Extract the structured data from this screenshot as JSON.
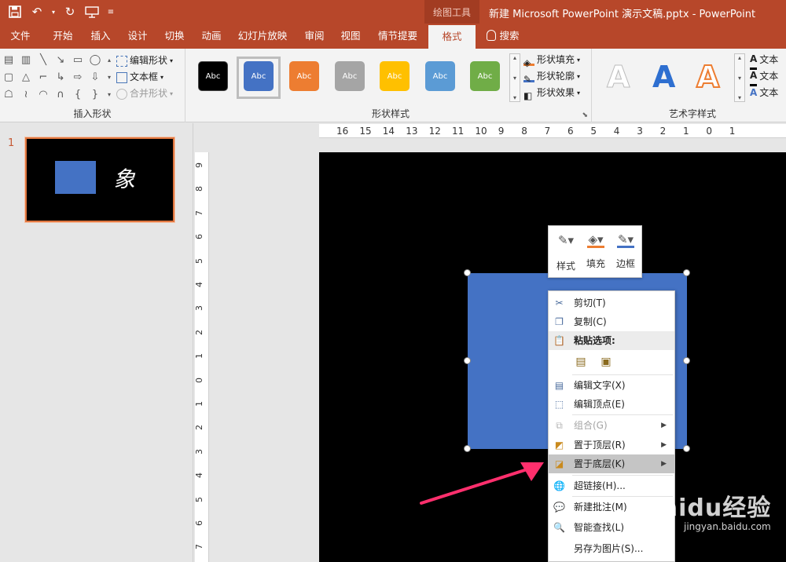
{
  "titlebar": {
    "contextual_tab_group": "绘图工具",
    "document_title": "新建 Microsoft PowerPoint 演示文稿.pptx  -  PowerPoint"
  },
  "tabs": [
    {
      "label": "文件"
    },
    {
      "label": "开始"
    },
    {
      "label": "插入"
    },
    {
      "label": "设计"
    },
    {
      "label": "切换"
    },
    {
      "label": "动画"
    },
    {
      "label": "幻灯片放映"
    },
    {
      "label": "审阅"
    },
    {
      "label": "视图"
    },
    {
      "label": "情节提要"
    },
    {
      "label": "格式",
      "active": true
    },
    {
      "label": "搜索"
    }
  ],
  "ribbon": {
    "insert_shapes": {
      "label": "插入形状",
      "edit_shape": "编辑形状",
      "text_box": "文本框",
      "merge_shapes": "合并形状"
    },
    "shape_styles": {
      "label": "形状样式",
      "swatches": [
        {
          "text": "Abc",
          "color": "#000000"
        },
        {
          "text": "Abc",
          "color": "#4472c4",
          "selected": true
        },
        {
          "text": "Abc",
          "color": "#ed7d31"
        },
        {
          "text": "Abc",
          "color": "#a5a5a5"
        },
        {
          "text": "Abc",
          "color": "#ffc000"
        },
        {
          "text": "Abc",
          "color": "#5b9bd5"
        },
        {
          "text": "Abc",
          "color": "#70ad47"
        }
      ],
      "fill": "形状填充",
      "outline": "形状轮廓",
      "effects": "形状效果"
    },
    "wordart": {
      "label": "艺术字样式",
      "letters": [
        "A",
        "A",
        "A"
      ],
      "text_fill": "文本",
      "text_outline": "文本",
      "text_effects": "文本"
    }
  },
  "thumbnails": {
    "slide_number": "1",
    "thumb_text": "象"
  },
  "ruler": {
    "horizontal": [
      "16",
      "15",
      "14",
      "13",
      "12",
      "11",
      "10",
      "9",
      "8",
      "7",
      "6",
      "5",
      "4",
      "3",
      "2",
      "1",
      "0",
      "1"
    ],
    "vertical": [
      "9",
      "8",
      "7",
      "6",
      "5",
      "4",
      "3",
      "2",
      "1",
      "0",
      "1",
      "2",
      "3",
      "4",
      "5",
      "6",
      "7"
    ]
  },
  "mini_toolbar": {
    "style": "样式",
    "fill": "填充",
    "border": "边框"
  },
  "context_menu": {
    "cut": "剪切(T)",
    "copy": "复制(C)",
    "paste_options": "粘贴选项:",
    "edit_text": "编辑文字(X)",
    "edit_points": "编辑顶点(E)",
    "group": "组合(G)",
    "bring_to_front": "置于顶层(R)",
    "send_to_back": "置于底层(K)",
    "hyperlink": "超链接(H)...",
    "new_comment": "新建批注(M)",
    "smart_lookup": "智能查找(L)",
    "save_as_picture": "另存为图片(S)..."
  },
  "watermark": {
    "logo": "Baidu经验",
    "url": "jingyan.baidu.com"
  },
  "colors": {
    "accent": "#b7472a",
    "shape_fill": "#4472c4",
    "annotation_arrow": "#ff2f6d"
  }
}
